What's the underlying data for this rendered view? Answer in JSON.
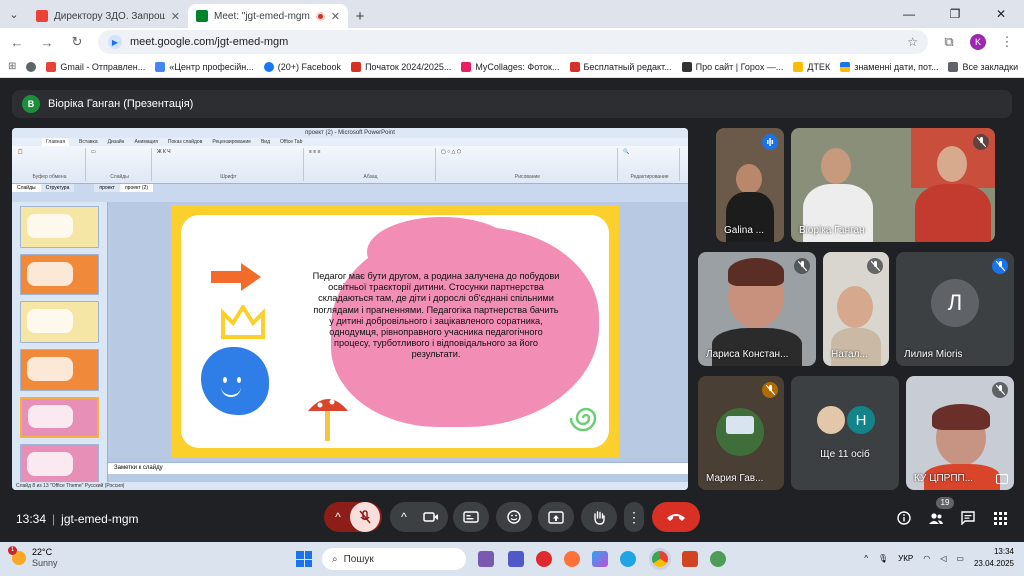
{
  "browser": {
    "tabs": [
      {
        "title": "Директору ЗДО. Запрошення",
        "active": false,
        "favicon_color": "#ea4335"
      },
      {
        "title": "Meet: \"jgt-emed-mgm\"",
        "active": true,
        "favicon_color": "#00832d"
      }
    ],
    "new_tab": "+",
    "address": "meet.google.com/jgt-emed-mgm",
    "profile_initial": "K",
    "bookmarks": [
      {
        "label": "Gmail - Отправлен...",
        "color": "#ea4335"
      },
      {
        "label": "«Центр професійн...",
        "color": "#4285f4"
      },
      {
        "label": "(20+) Facebook",
        "color": "#1877f2"
      },
      {
        "label": "Початок 2024/2025...",
        "color": "#d93025"
      },
      {
        "label": "MyCollages: Фоток...",
        "color": "#e91e63"
      },
      {
        "label": "Бесплатный редакт...",
        "color": "#d93025"
      },
      {
        "label": "Про сайт | Горох —...",
        "color": "#333333"
      },
      {
        "label": "ДТЕК",
        "color": "#fbbc04"
      },
      {
        "label": "знаменні дати, пот...",
        "color": "#1a73e8"
      }
    ],
    "all_bookmarks": "Все закладки"
  },
  "meet": {
    "presenter_initial": "В",
    "presenter_title": "Віоріка Ганган (Презентація)",
    "time": "13:34",
    "meeting_code": "jgt-emed-mgm",
    "participants_count": "19",
    "tiles": [
      {
        "name": "Galina ..."
      },
      {
        "name": "Віоріка Ганган"
      },
      {
        "name": "Лариса Констан..."
      },
      {
        "name": "Натал..."
      },
      {
        "name": "Лилия Мioris",
        "initial": "Л"
      },
      {
        "name": "Мария Гав..."
      },
      {
        "name": "Ще 11 осіб",
        "initial": "Н"
      },
      {
        "name": "КУ ЦПРПП..."
      }
    ]
  },
  "powerpoint": {
    "title": "проект (2) - Microsoft PowerPoint",
    "ribbon_tabs": [
      "Главная",
      "Вставка",
      "Дизайн",
      "Анимация",
      "Показ слайдов",
      "Рецензирование",
      "Вид",
      "Office Tab"
    ],
    "ribbon_groups": [
      "Буфер обмена",
      "Слайды",
      "Шрифт",
      "Абзац",
      "Рисование",
      "Редактирование"
    ],
    "doc_tabs": [
      "проект",
      "проект (2)"
    ],
    "panel_tabs": [
      "Слайды",
      "Структура"
    ],
    "slide_text": "Педагог має бути другом, а родина залучена до побудови освітньої траєкторії дитини. Стосунки партнерства складаються там, де діти і дорослі об'єднані спільними поглядами і прагненнями. Педагогіка партнерства бачить у дитині добровільного і зацікавленого соратника, однодумця, рівноправного учасника педагогічного процесу, турботливого і відповідального за його результати.",
    "notes_placeholder": "Заметки к слайду",
    "status": "Слайд 8 из 13   \"Office Theme\"   Русский (Россия)"
  },
  "taskbar": {
    "weather_temp": "22°C",
    "weather_desc": "Sunny",
    "weather_badge": "1",
    "search_placeholder": "Пошук",
    "language": "УКР",
    "time": "13:34",
    "date": "23.04.2025"
  }
}
